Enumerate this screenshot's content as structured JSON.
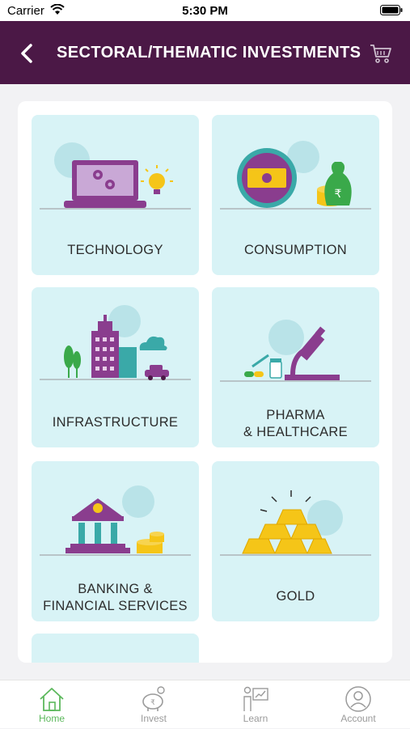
{
  "status_bar": {
    "carrier": "Carrier",
    "time": "5:30 PM"
  },
  "header": {
    "title": "SECTORAL/THEMATIC INVESTMENTS"
  },
  "categories": [
    {
      "label_line1": "TECHNOLOGY",
      "label_line2": ""
    },
    {
      "label_line1": "CONSUMPTION",
      "label_line2": ""
    },
    {
      "label_line1": "INFRASTRUCTURE",
      "label_line2": ""
    },
    {
      "label_line1": "PHARMA",
      "label_line2": "& HEALTHCARE"
    },
    {
      "label_line1": "BANKING &",
      "label_line2": "FINANCIAL SERVICES"
    },
    {
      "label_line1": "GOLD",
      "label_line2": ""
    }
  ],
  "tabs": [
    {
      "label": "Home",
      "active": true
    },
    {
      "label": "Invest",
      "active": false
    },
    {
      "label": "Learn",
      "active": false
    },
    {
      "label": "Account",
      "active": false
    }
  ],
  "colors": {
    "header_bg": "#4b1846",
    "card_bg": "#d8f3f6",
    "active_tab": "#5cb85c",
    "purple": "#8a3d8e",
    "gold": "#f5c518"
  }
}
